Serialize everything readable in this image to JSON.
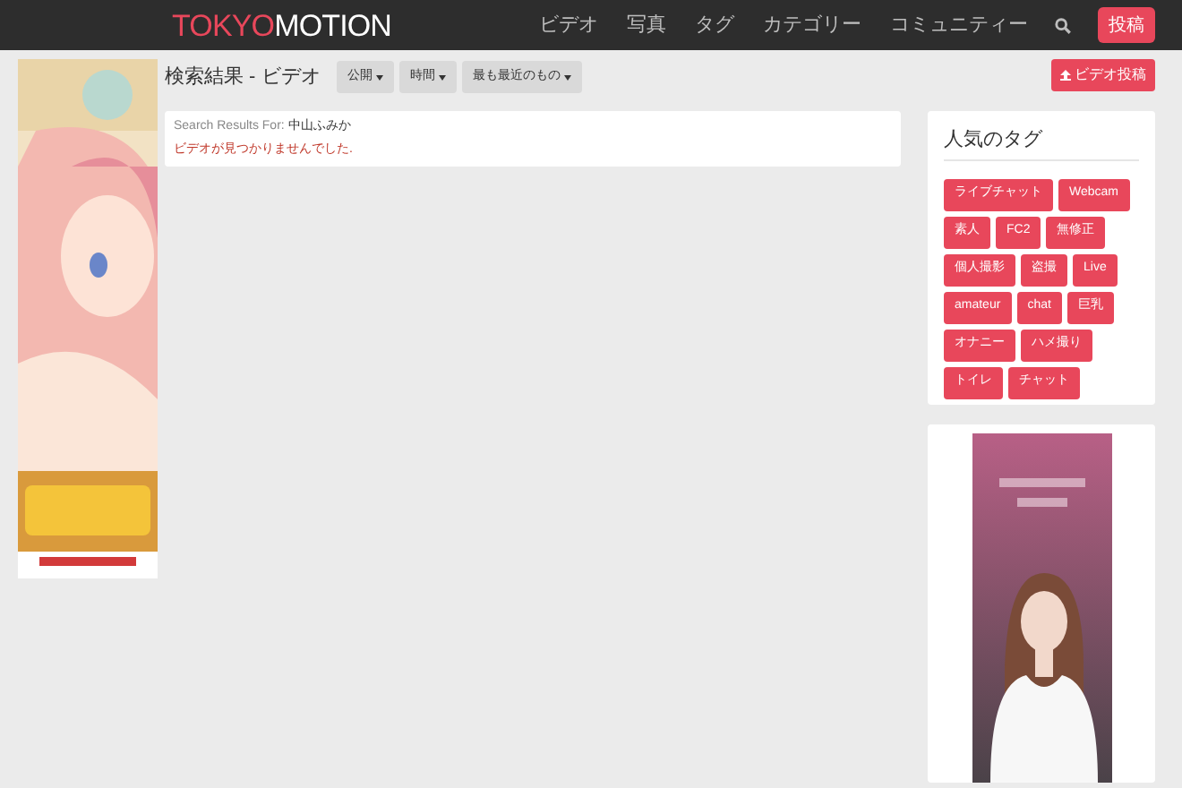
{
  "navbar": {
    "logo": {
      "left": "TOKY",
      "mark": "O",
      "right": "MOTION"
    },
    "links": [
      {
        "label": "ビデオ"
      },
      {
        "label": "写真"
      },
      {
        "label": "タグ"
      },
      {
        "label": "カテゴリー"
      },
      {
        "label": "コミュニティー"
      }
    ],
    "post_button": "投稿"
  },
  "heading": "検索結果 - ビデオ",
  "filters": [
    {
      "label": "公開"
    },
    {
      "label": "時間"
    },
    {
      "label": "最も最近のもの"
    }
  ],
  "upload_button": "ビデオ投稿",
  "results": {
    "query_label": "Search Results For:",
    "query": "中山ふみか",
    "message": "ビデオが見つかりませんでした."
  },
  "popular_tags": {
    "title": "人気のタグ",
    "tags": [
      "ライブチャット",
      "Webcam",
      "素人",
      "FC2",
      "無修正",
      "個人撮影",
      "盗撮",
      "Live",
      "amateur",
      "chat",
      "巨乳",
      "オナニー",
      "ハメ撮り",
      "トイレ",
      "チャット"
    ]
  }
}
